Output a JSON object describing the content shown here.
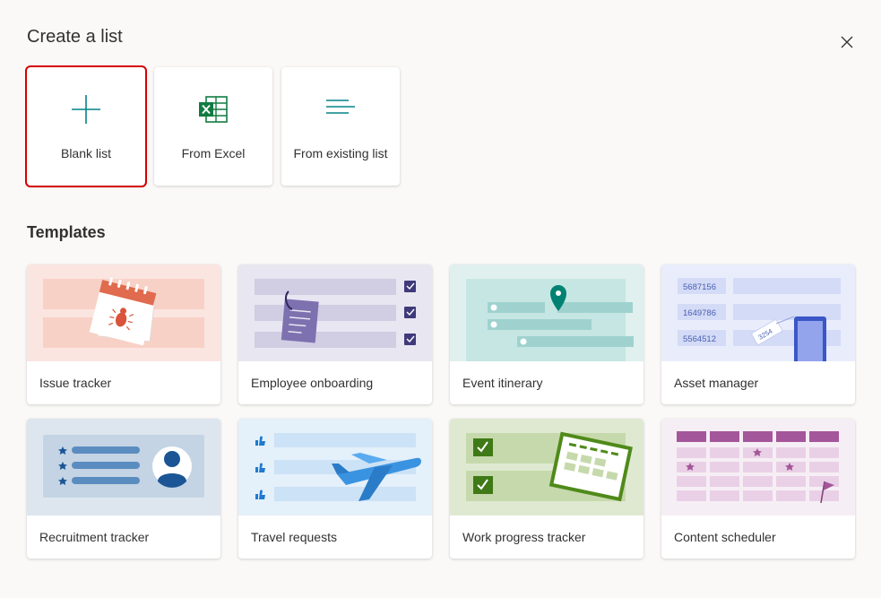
{
  "dialog": {
    "title": "Create a list",
    "close_icon": "close-icon"
  },
  "create_options": [
    {
      "label": "Blank list",
      "icon": "plus-icon",
      "selected": true
    },
    {
      "label": "From Excel",
      "icon": "excel-icon",
      "selected": false
    },
    {
      "label": "From existing list",
      "icon": "list-lines-icon",
      "selected": false
    }
  ],
  "templates": {
    "title": "Templates",
    "items": [
      {
        "name": "Issue tracker"
      },
      {
        "name": "Employee onboarding"
      },
      {
        "name": "Event itinerary"
      },
      {
        "name": "Asset manager",
        "art_numbers": [
          "5687156",
          "1649786",
          "5564512"
        ],
        "tag_number": "3254"
      },
      {
        "name": "Recruitment tracker"
      },
      {
        "name": "Travel requests"
      },
      {
        "name": "Work progress tracker"
      },
      {
        "name": "Content scheduler"
      }
    ]
  },
  "colors": {
    "accent": "#038387",
    "excel": "#107c41",
    "selection_outline": "#d40000"
  }
}
